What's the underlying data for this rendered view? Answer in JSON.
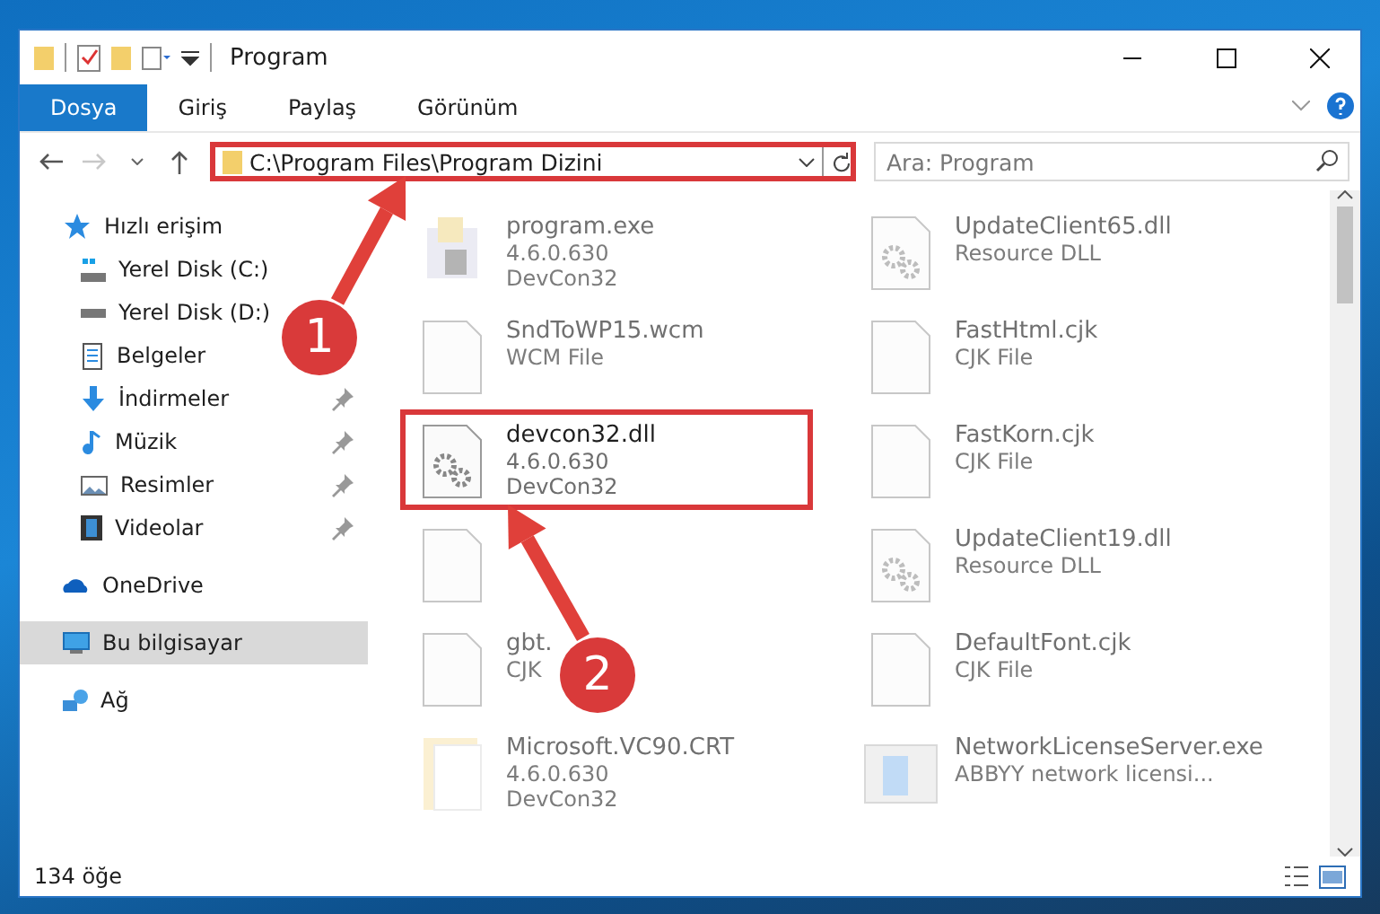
{
  "window": {
    "title": "Program"
  },
  "ribbon_tabs": [
    {
      "label": "Dosya",
      "selected": true
    },
    {
      "label": "Giriş",
      "selected": false
    },
    {
      "label": "Paylaş",
      "selected": false
    },
    {
      "label": "Görünüm",
      "selected": false
    }
  ],
  "address_bar": {
    "path": "C:\\Program Files\\Program Dizini",
    "highlighted": true
  },
  "search": {
    "placeholder": "Ara: Program"
  },
  "sidebar": {
    "items": [
      {
        "label": "Hızlı erişim",
        "kind": "star",
        "selected": false,
        "children": [
          {
            "label": "Yerel Disk (C:)",
            "kind": "system-drive",
            "pinned": false
          },
          {
            "label": "Yerel Disk (D:)",
            "kind": "drive",
            "pinned": false
          },
          {
            "label": "Belgeler",
            "kind": "documents",
            "pinned": false
          },
          {
            "label": "İndirmeler",
            "kind": "downloads",
            "pinned": true
          },
          {
            "label": "Müzik",
            "kind": "music",
            "pinned": true
          },
          {
            "label": "Resimler",
            "kind": "pictures",
            "pinned": true
          },
          {
            "label": "Videolar",
            "kind": "videos",
            "pinned": true
          }
        ]
      },
      {
        "label": "OneDrive",
        "kind": "cloud",
        "selected": false
      },
      {
        "label": "Bu bilgisayar",
        "kind": "computer",
        "selected": true
      },
      {
        "label": "Ağ",
        "kind": "network",
        "selected": false
      }
    ]
  },
  "files": [
    {
      "kind": "exe",
      "name": "program.exe",
      "lines": [
        "4.6.0.630",
        "DevCon32"
      ],
      "faded": true,
      "highlighted": false
    },
    {
      "kind": "dll",
      "name": "UpdateClient65.dll",
      "lines": [
        "Resource DLL"
      ],
      "faded": true,
      "highlighted": false
    },
    {
      "kind": "file",
      "name": "SndToWP15.wcm",
      "lines": [
        "WCM File"
      ],
      "faded": true,
      "highlighted": false
    },
    {
      "kind": "file",
      "name": "FastHtml.cjk",
      "lines": [
        "CJK File"
      ],
      "faded": true,
      "highlighted": false
    },
    {
      "kind": "dll",
      "name": "devcon32.dll",
      "lines": [
        "4.6.0.630",
        "DevCon32"
      ],
      "faded": false,
      "highlighted": true
    },
    {
      "kind": "file",
      "name": "FastKorn.cjk",
      "lines": [
        "CJK File"
      ],
      "faded": true,
      "highlighted": false
    },
    {
      "kind": "file",
      "faded": true,
      "highlighted": false
    },
    {
      "kind": "dll",
      "name": "UpdateClient19.dll",
      "lines": [
        "Resource DLL"
      ],
      "faded": true,
      "highlighted": false
    },
    {
      "kind": "file",
      "name": "gbt.",
      "lines": [
        "CJK"
      ],
      "faded": true,
      "highlighted": false
    },
    {
      "kind": "file",
      "name": "DefaultFont.cjk",
      "lines": [
        "CJK File"
      ],
      "faded": true,
      "highlighted": false
    },
    {
      "kind": "folder",
      "name": "Microsoft.VC90.CRT",
      "lines": [
        "4.6.0.630",
        "DevCon32"
      ],
      "faded": true,
      "highlighted": false
    },
    {
      "kind": "app",
      "name": "NetworkLicenseServer.exe",
      "lines": [
        "ABBYY network licensi..."
      ],
      "faded": true,
      "highlighted": false
    }
  ],
  "status_bar": {
    "item_count": "134 öğe"
  },
  "annotations": [
    {
      "label": "1"
    },
    {
      "label": "2"
    }
  ]
}
